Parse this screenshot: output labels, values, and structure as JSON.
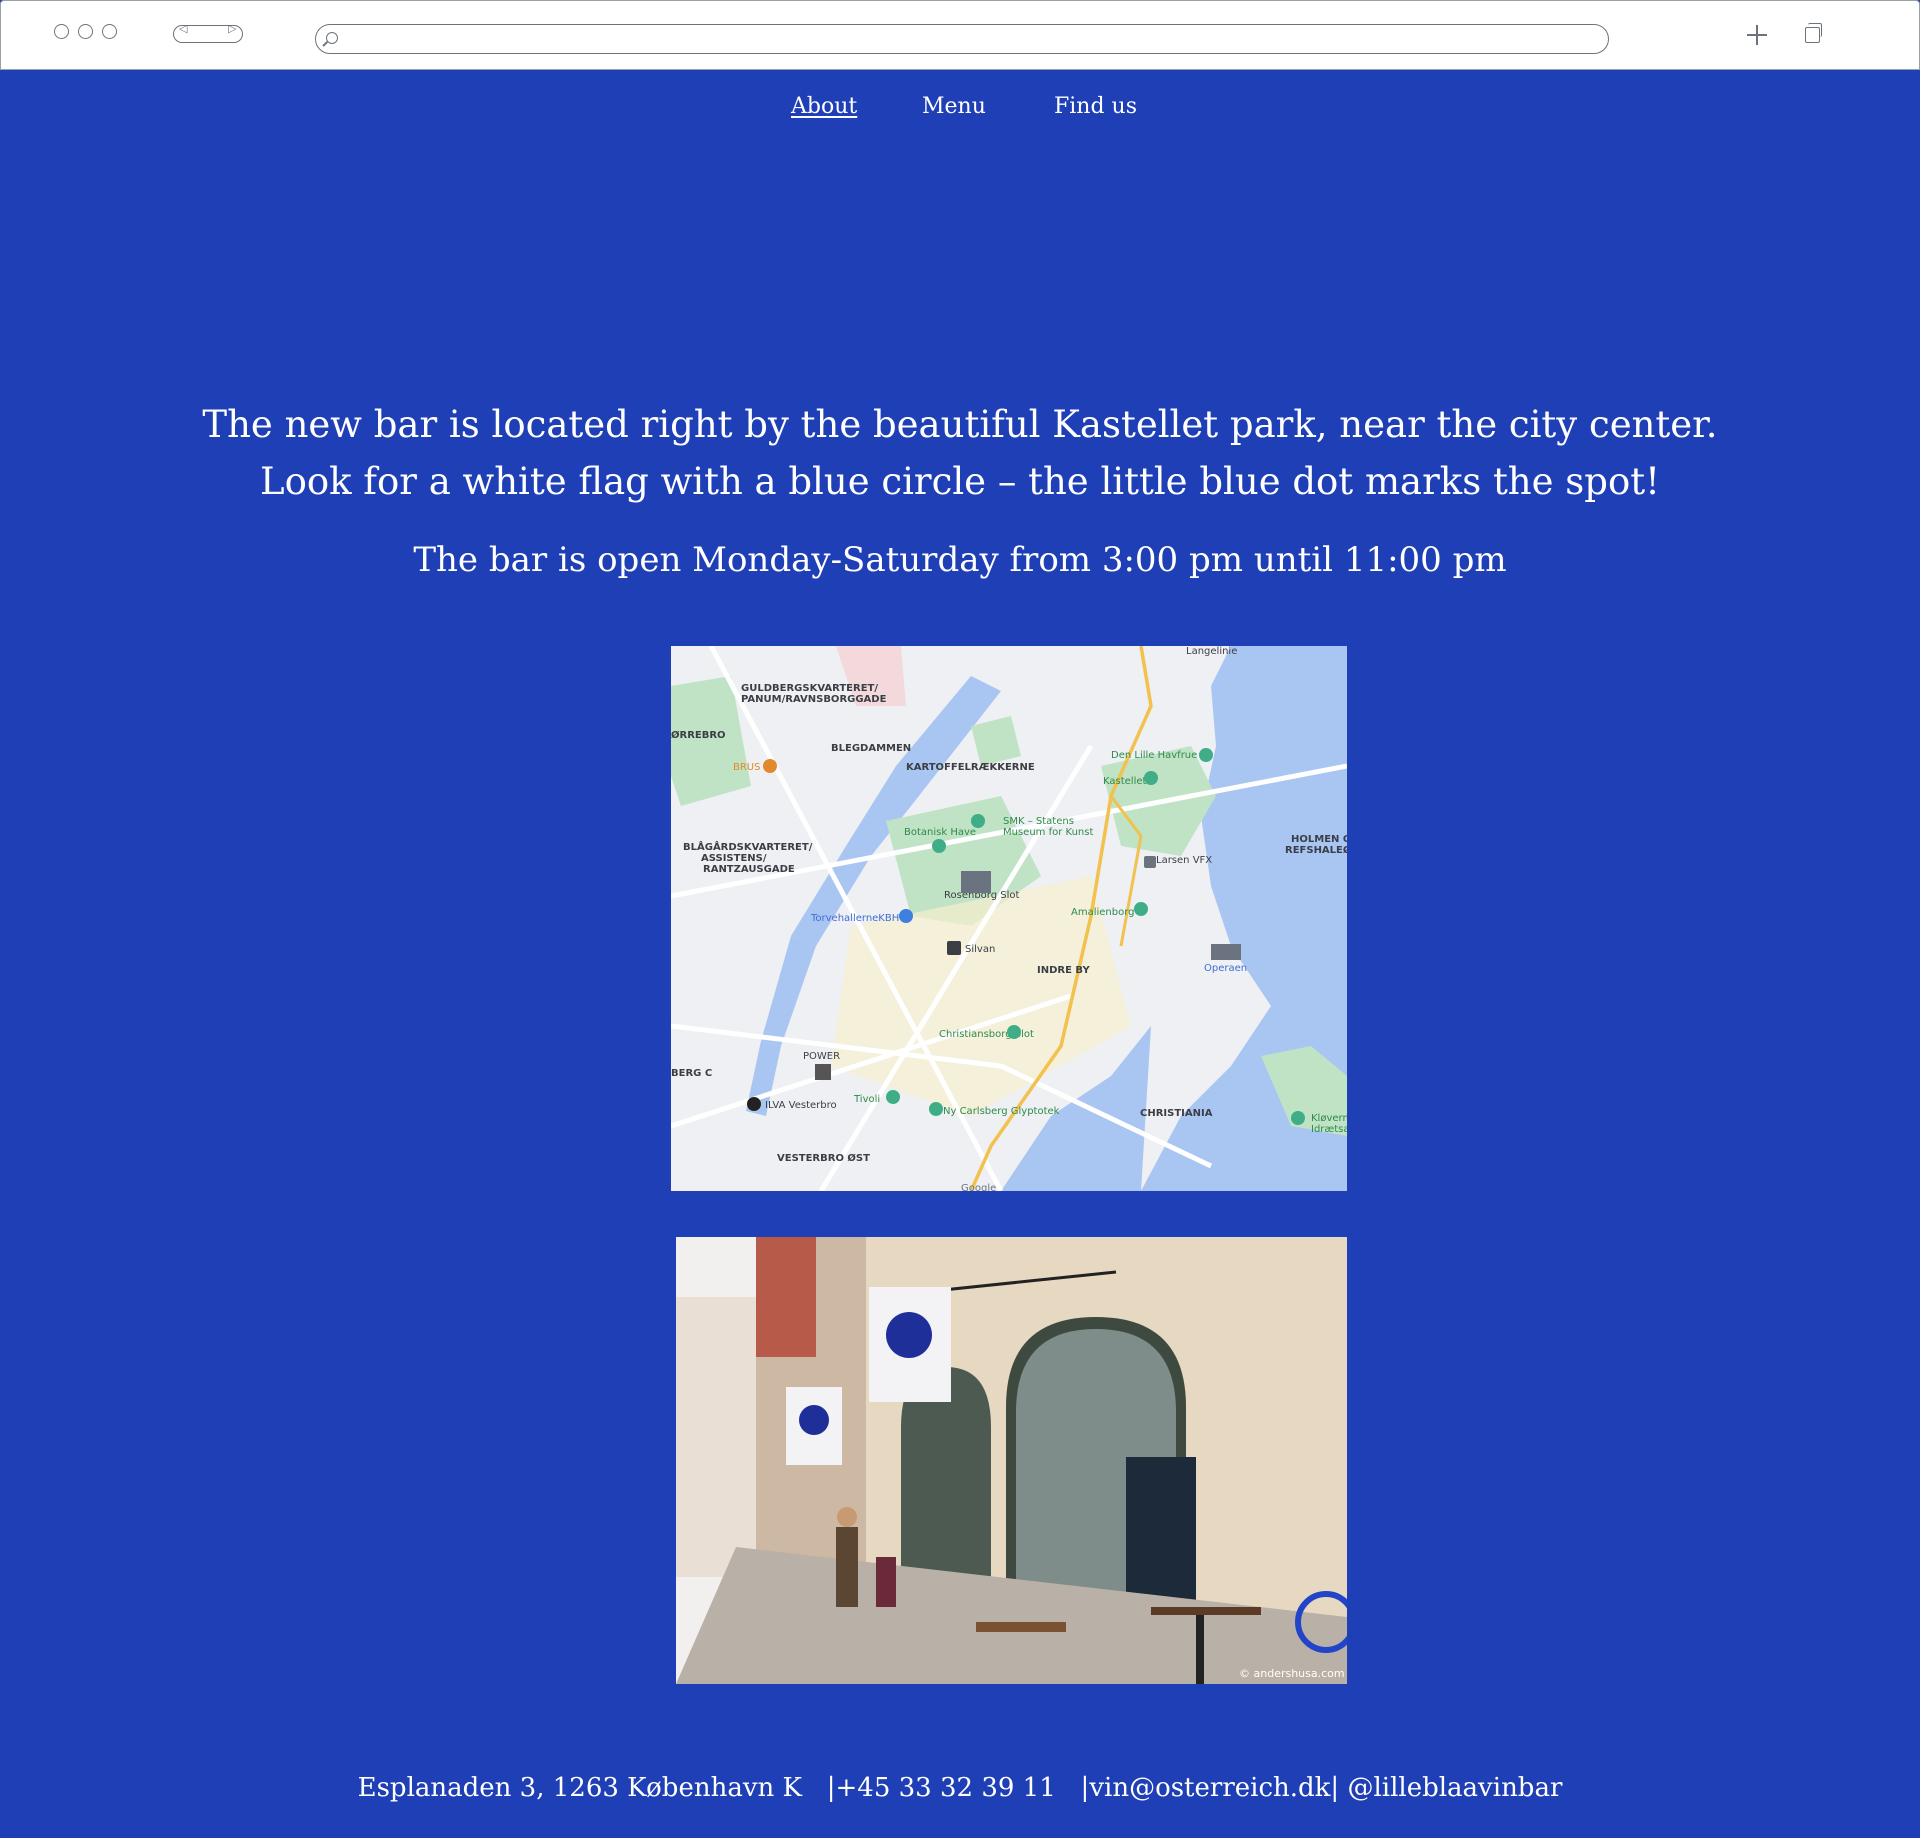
{
  "browser": {
    "window_buttons": [
      "window-close-dot",
      "window-minimize-dot",
      "window-maximize-dot"
    ],
    "back_icon": "◁",
    "forward_icon": "▷",
    "url": ""
  },
  "nav": {
    "items": [
      {
        "label": "About",
        "active": true
      },
      {
        "label": "Menu",
        "active": false
      },
      {
        "label": "Find us",
        "active": false
      }
    ]
  },
  "content": {
    "intro_line1": "The new bar is located right by the beautiful Kastellet park, near the city center.",
    "intro_line2": "Look for a white flag with a blue circle – the little blue dot marks the spot!",
    "hours": "The bar is open Monday-Saturday from 3:00 pm until 11:00 pm"
  },
  "map": {
    "labels": {
      "guldberg": "GULDBERGSKVARTERET/",
      "panum": "PANUM/RAVNSBORGGADE",
      "norrebro": "ØRREBRO",
      "blegdammen": "BLEGDAMMEN",
      "kartoffel": "KARTOFFELRÆKKERNE",
      "brus": "BRUS",
      "den_lille_havfrue": "Den Lille Havfrue",
      "kastellet": "Kastellet",
      "smk1": "SMK – Statens",
      "smk2": "Museum for Kunst",
      "botanisk": "Botanisk Have",
      "blaagaard1": "BLÅGÅRDSKVARTERET/",
      "blaagaard2": "ASSISTENS/",
      "blaagaard3": "RANTZAUSGADE",
      "rosenborg": "Rosenborg Slot",
      "torvehallerne": "TorvehallerneKBH",
      "larsen": "Larsen VFX",
      "holmen1": "HOLMEN O",
      "holmen2": "REFSHALEØ",
      "amalienborg": "Amalienborg",
      "silvan": "Silvan",
      "indre_by": "INDRE BY",
      "operaen": "Operaen",
      "christiansborg": "Christiansborg Slot",
      "power": "POWER",
      "berg": "BERG C",
      "ilva": "ILVA Vesterbro",
      "tivoli": "Tivoli",
      "glyptotek": "Ny Carlsberg Glyptotek",
      "christiania": "CHRISTIANIA",
      "klovermark1": "Kløverm",
      "klovermark2": "Idrætsar",
      "vesterbro": "VESTERBRO ØST",
      "langelinie": "Langelinie",
      "google": "Google"
    }
  },
  "photo": {
    "credit": "© andershusa.com"
  },
  "footer": {
    "text": "Esplanaden 3, 1263 København K   |+45 33 32 39 11   |vin@osterreich.dk| @lilleblaavinbar"
  },
  "colors": {
    "background": "#1f3fb6",
    "text": "#ffffff"
  }
}
